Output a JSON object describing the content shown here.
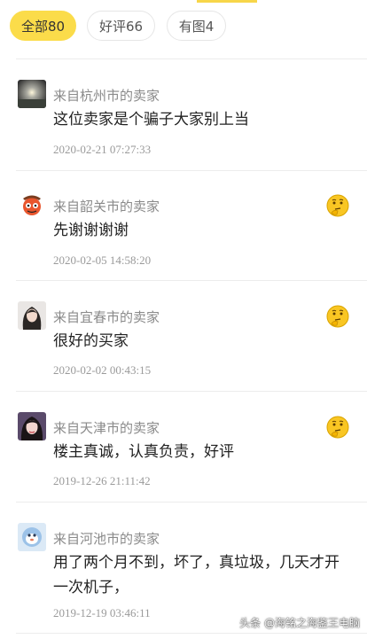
{
  "filters": {
    "all_label": "全部80",
    "good_label": "好评66",
    "pic_label": "有图4"
  },
  "reviews": [
    {
      "reviewer": "来自杭州市的卖家",
      "comment": "这位卖家是个骗子大家别上当",
      "time": "2020-02-21 07:27:33"
    },
    {
      "reviewer": "来自韶关市的卖家",
      "comment": "先谢谢谢谢",
      "time": "2020-02-05 14:58:20",
      "reaction_icon": "thinking-face-icon"
    },
    {
      "reviewer": "来自宜春市的卖家",
      "comment": "很好的买家",
      "time": "2020-02-02 00:43:15",
      "reaction_icon": "thinking-face-icon"
    },
    {
      "reviewer": "来自天津市的卖家",
      "comment": "楼主真诚，认真负责，好评",
      "time": "2019-12-26 21:11:42",
      "reaction_icon": "thinking-face-icon"
    },
    {
      "reviewer": "来自河池市的卖家",
      "comment": "用了两个月不到，坏了，真垃圾，几天才开一次机子，",
      "time": "2019-12-19 03:46:11"
    }
  ],
  "watermark": "头条 @海铭之海鉴王电脑",
  "colors": {
    "accent": "#fbdc4a",
    "text_primary": "#222222",
    "text_secondary": "#8a8a8a"
  }
}
